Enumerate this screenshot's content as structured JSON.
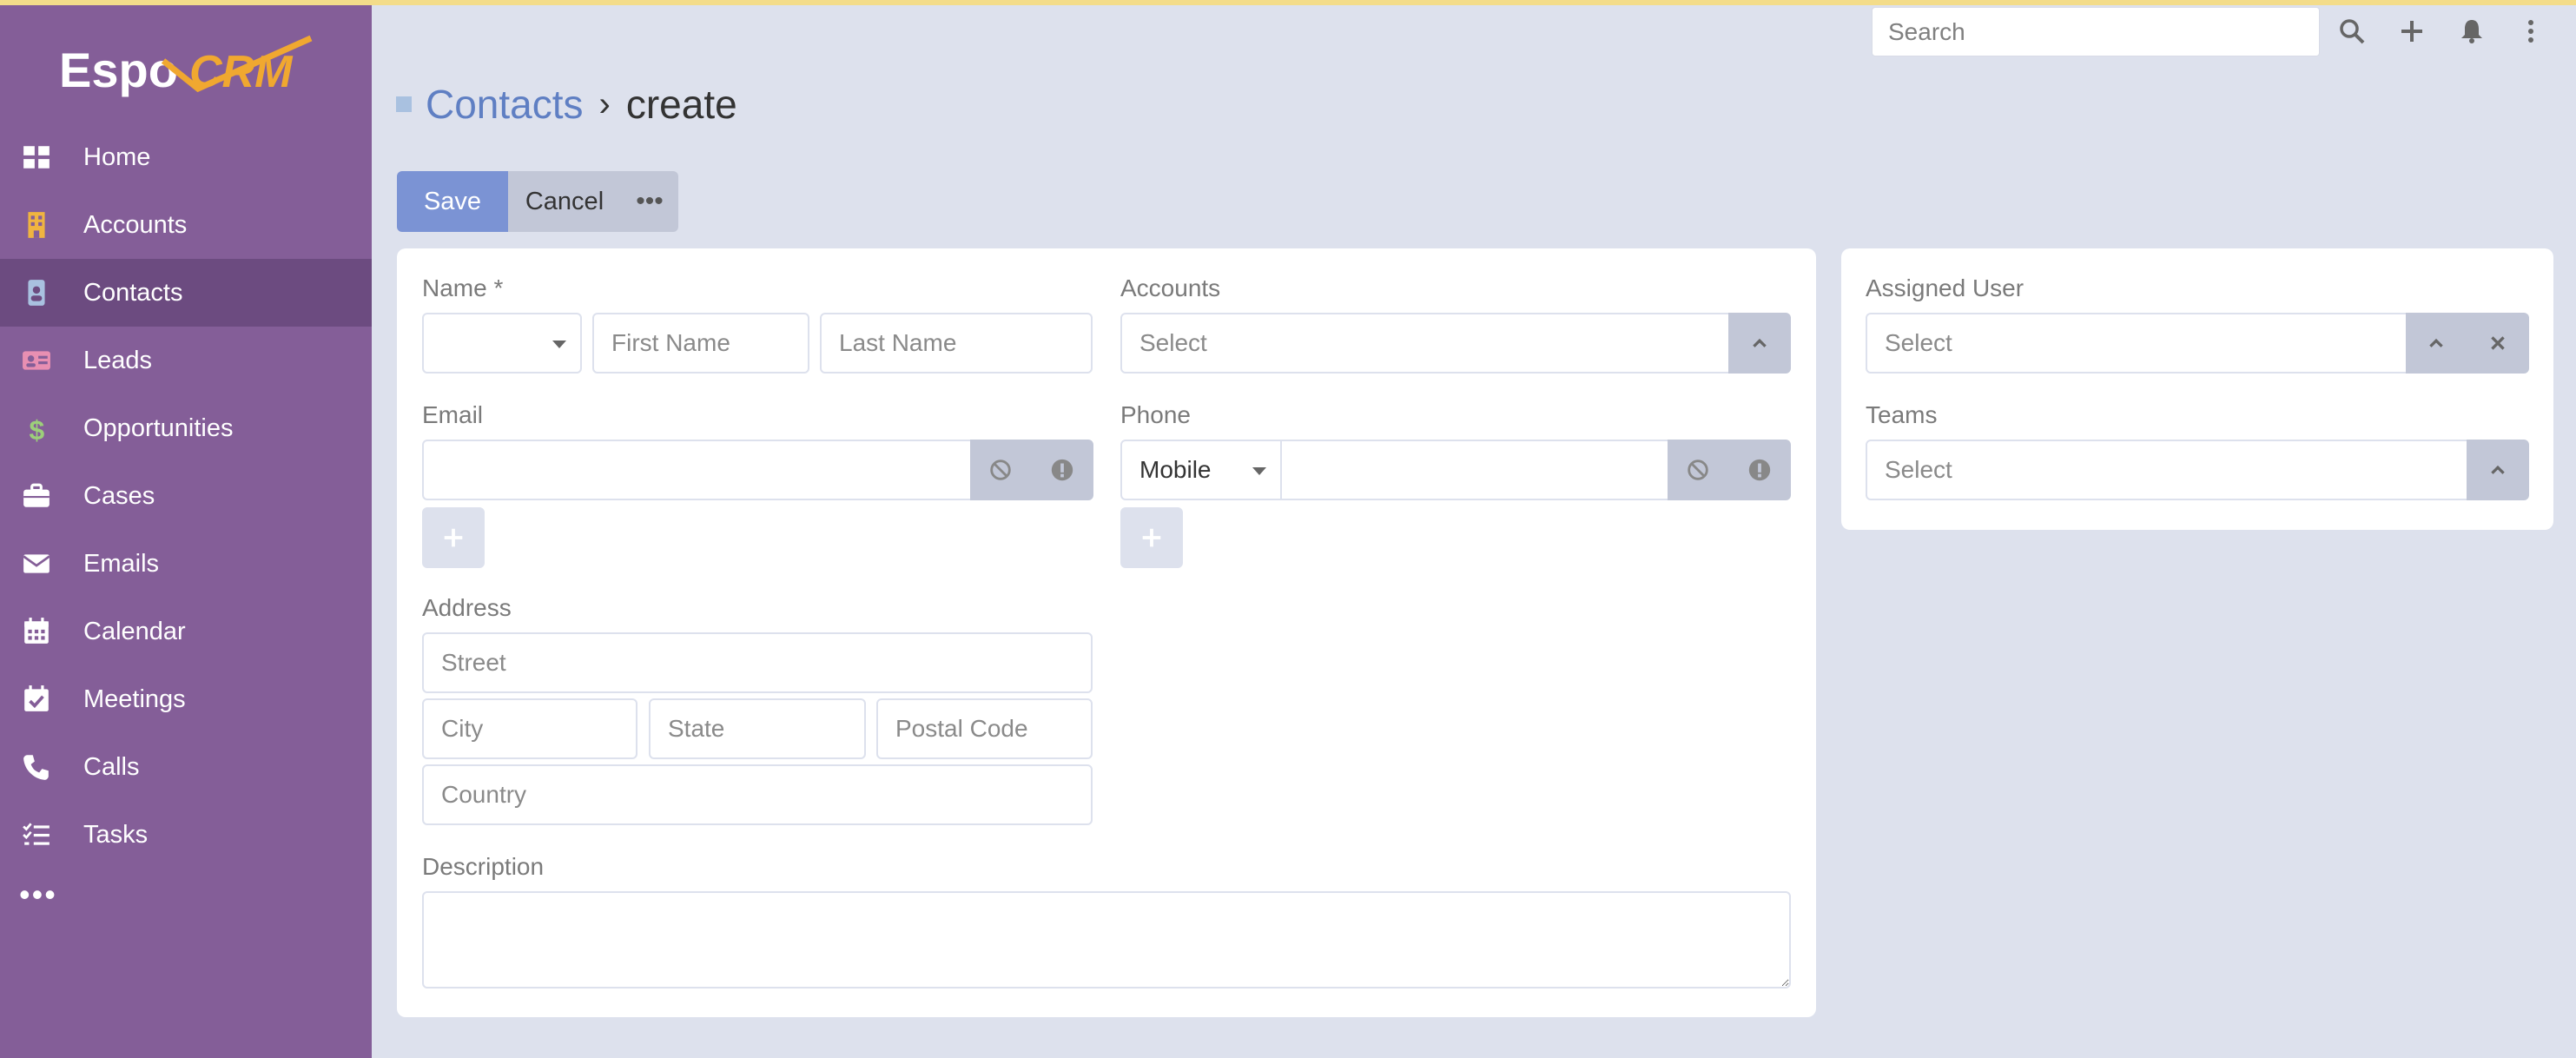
{
  "app": {
    "logo_text": "EspoCRM"
  },
  "sidebar": {
    "items": [
      {
        "label": "Home",
        "icon": "grid-icon"
      },
      {
        "label": "Accounts",
        "icon": "building-icon"
      },
      {
        "label": "Contacts",
        "icon": "contact-card-icon"
      },
      {
        "label": "Leads",
        "icon": "id-card-icon"
      },
      {
        "label": "Opportunities",
        "icon": "dollar-icon"
      },
      {
        "label": "Cases",
        "icon": "briefcase-icon"
      },
      {
        "label": "Emails",
        "icon": "envelope-icon"
      },
      {
        "label": "Calendar",
        "icon": "calendar-icon"
      },
      {
        "label": "Meetings",
        "icon": "calendar-check-icon"
      },
      {
        "label": "Calls",
        "icon": "phone-icon"
      },
      {
        "label": "Tasks",
        "icon": "tasks-icon"
      }
    ],
    "more": "•••"
  },
  "topbar": {
    "search_placeholder": "Search"
  },
  "header": {
    "module": "Contacts",
    "separator": "›",
    "action": "create"
  },
  "buttons": {
    "save": "Save",
    "cancel": "Cancel",
    "more": "•••"
  },
  "form": {
    "name_label": "Name *",
    "first_name_placeholder": "First Name",
    "last_name_placeholder": "Last Name",
    "salutation_value": "",
    "accounts_label": "Accounts",
    "accounts_placeholder": "Select",
    "email_label": "Email",
    "phone_label": "Phone",
    "phone_type": "Mobile",
    "address_label": "Address",
    "street_placeholder": "Street",
    "city_placeholder": "City",
    "state_placeholder": "State",
    "postal_placeholder": "Postal Code",
    "country_placeholder": "Country",
    "description_label": "Description"
  },
  "side": {
    "assigned_user_label": "Assigned User",
    "assigned_user_placeholder": "Select",
    "teams_label": "Teams",
    "teams_placeholder": "Select"
  },
  "colors": {
    "sidebar": "#845e98",
    "sidebar_active": "#6c4b80",
    "primary": "#7b93d4",
    "link": "#5f7fc3",
    "logo_accent": "#f0a830"
  }
}
